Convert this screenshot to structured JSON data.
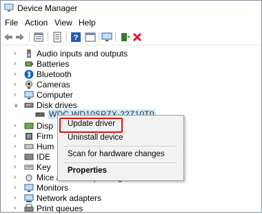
{
  "window": {
    "title": "Device Manager",
    "icon": "device-manager-icon"
  },
  "menu": [
    "File",
    "Action",
    "View",
    "Help"
  ],
  "toolbar": [
    "back-icon",
    "forward-icon",
    "properties-icon",
    "list-icon",
    "help-icon",
    "monitor-icon",
    "scan-icon",
    "remove-icon"
  ],
  "tree": [
    {
      "label": "Audio inputs and outputs",
      "icon": "speaker-icon",
      "expanded": false
    },
    {
      "label": "Batteries",
      "icon": "battery-icon",
      "expanded": false
    },
    {
      "label": "Bluetooth",
      "icon": "bluetooth-icon",
      "expanded": false
    },
    {
      "label": "Cameras",
      "icon": "camera-icon",
      "expanded": false
    },
    {
      "label": "Computer",
      "icon": "computer-icon",
      "expanded": false
    },
    {
      "label": "Disk drives",
      "icon": "disk-icon",
      "expanded": true
    },
    {
      "label": "Disp",
      "icon": "display-icon",
      "expanded": false
    },
    {
      "label": "Firm",
      "icon": "firmware-icon",
      "expanded": false
    },
    {
      "label": "Hum",
      "icon": "hid-icon",
      "expanded": false
    },
    {
      "label": "IDE",
      "icon": "ide-icon",
      "expanded": false
    },
    {
      "label": "Key",
      "icon": "keyboard-icon",
      "expanded": false
    },
    {
      "label": "Mice and other pointing devices",
      "icon": "mouse-icon",
      "expanded": false
    },
    {
      "label": "Monitors",
      "icon": "monitor-icon",
      "expanded": false
    },
    {
      "label": "Network adapters",
      "icon": "network-icon",
      "expanded": false
    },
    {
      "label": "Print queues",
      "icon": "printer-icon",
      "expanded": false
    }
  ],
  "disk_child": "WDC WD10SPZX-22Z10T0",
  "context_menu": {
    "update_driver": "Update driver",
    "uninstall_device": "Uninstall device",
    "scan": "Scan for hardware changes",
    "properties": "Properties"
  },
  "colors": {
    "selection": "#cce8ff",
    "highlight_box": "#dd1111",
    "remove": "#e81123",
    "bluetooth": "#1565c0"
  }
}
